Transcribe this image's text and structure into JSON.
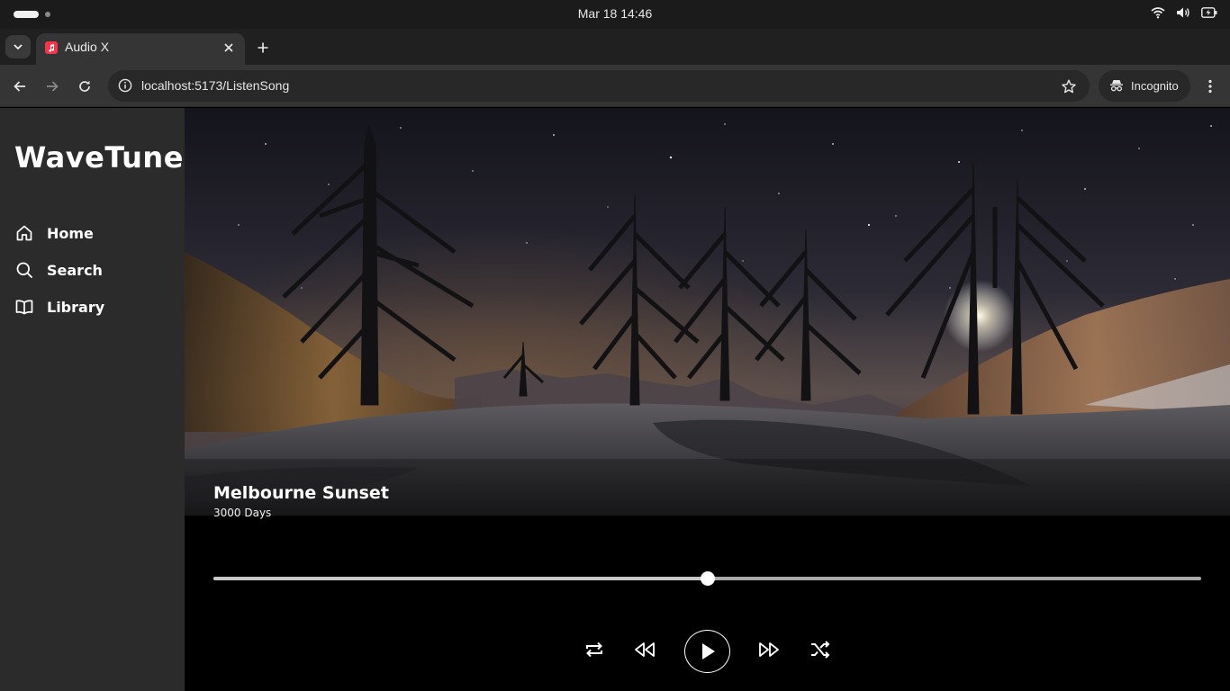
{
  "os": {
    "clock": "Mar 18  14:46"
  },
  "browser": {
    "tab_title": "Audio X",
    "url": "localhost:5173/ListenSong",
    "incognito_label": "Incognito"
  },
  "sidebar": {
    "brand": "WaveTune",
    "items": [
      {
        "label": "Home",
        "icon": "home-icon"
      },
      {
        "label": "Search",
        "icon": "search-icon"
      },
      {
        "label": "Library",
        "icon": "book-icon"
      }
    ]
  },
  "player": {
    "title": "Melbourne Sunset",
    "artist": "3000 Days",
    "progress": 0.5
  },
  "colors": {
    "sidebar_bg": "#2b2b2b",
    "main_bg": "#000000",
    "tab_favicon": "#f2364b"
  }
}
